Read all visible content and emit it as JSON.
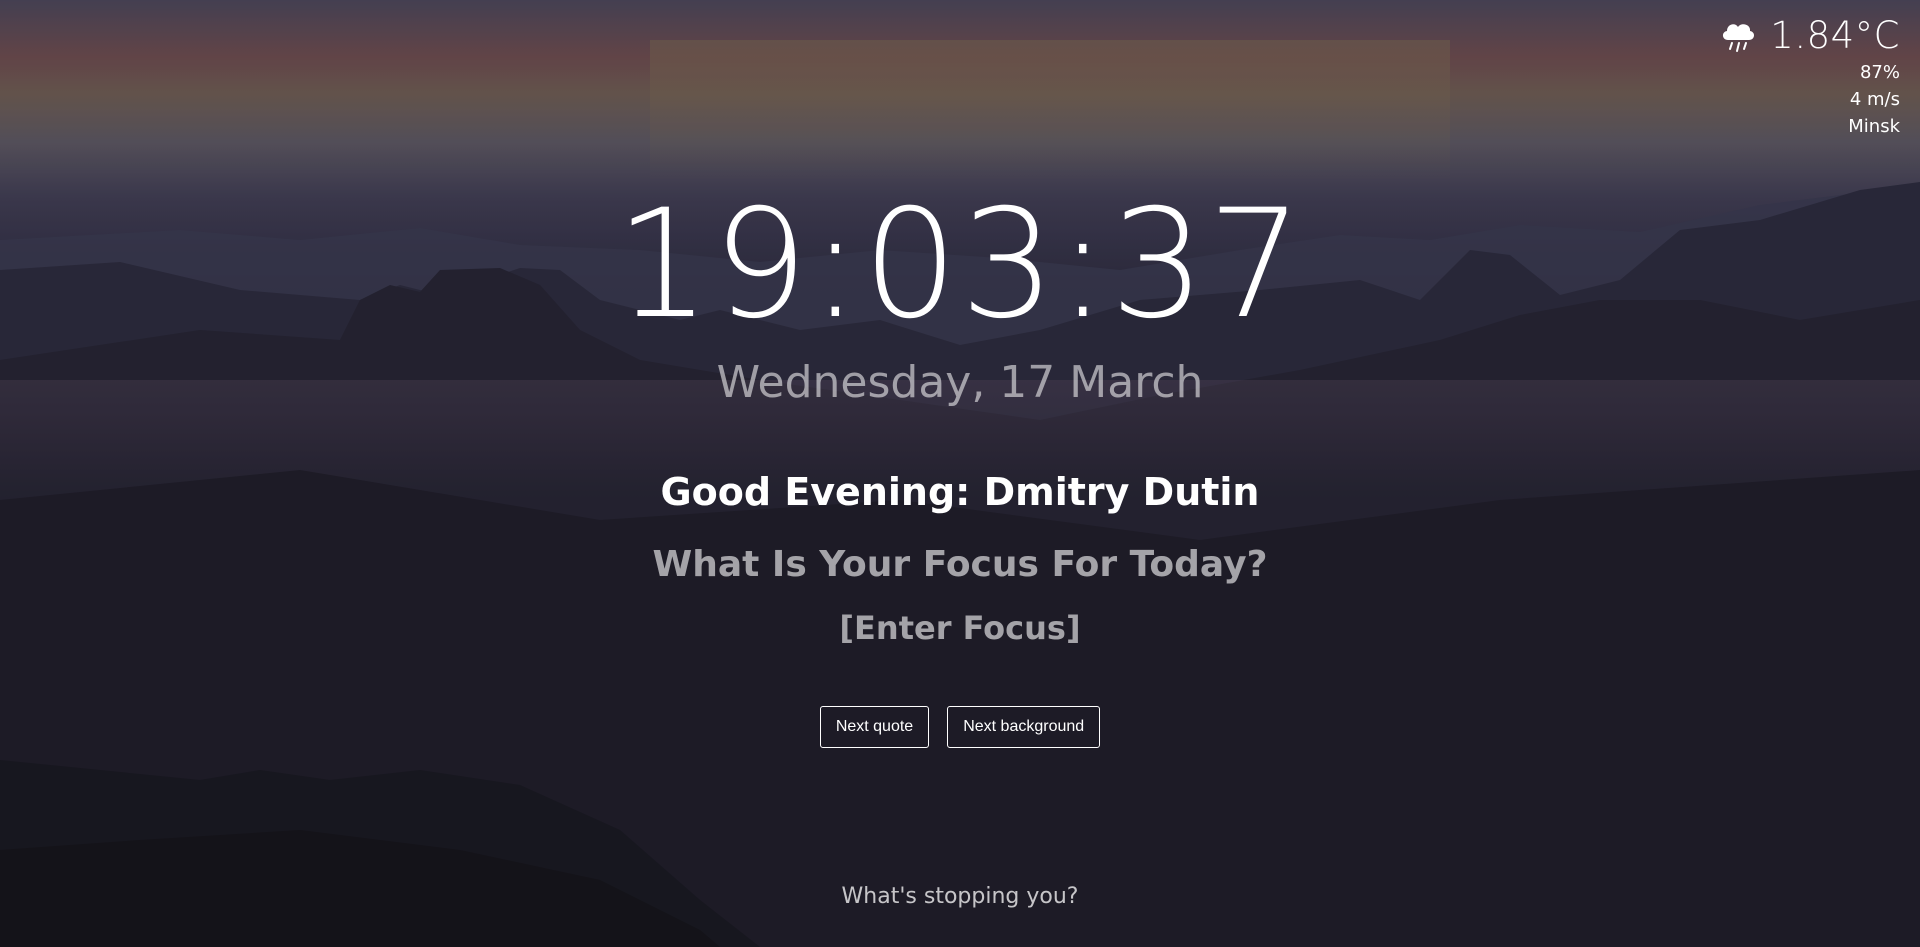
{
  "weather": {
    "icon": "rain-cloud-icon",
    "temperature": "1.84°C",
    "humidity": "87%",
    "wind": "4 m/s",
    "city": "Minsk"
  },
  "clock": {
    "time": "19:03:37",
    "date": "Wednesday, 17 March"
  },
  "greeting": {
    "text": "Good Evening: Dmitry Dutin"
  },
  "focus": {
    "question": "What Is Your Focus For Today?",
    "value": "[Enter Focus]"
  },
  "buttons": {
    "next_quote": "Next quote",
    "next_background": "Next background"
  },
  "quote": {
    "text": "What's stopping you?"
  },
  "colors": {
    "text": "#ffffff",
    "sky_accent": "#6a4a4e"
  }
}
